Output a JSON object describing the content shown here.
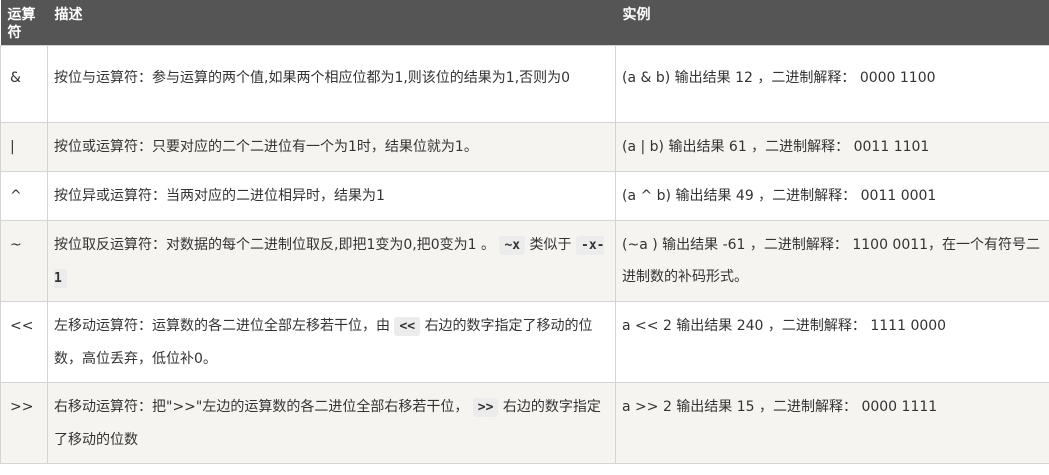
{
  "header": {
    "col_operator": "运算符",
    "col_description": "描述",
    "col_example": "实例"
  },
  "rows": [
    {
      "operator": "&",
      "description": "按位与运算符：参与运算的两个值,如果两个相应位都为1,则该位的结果为1,否则为0",
      "example": "(a & b) 输出结果 12 ，二进制解释： 0000 1100"
    },
    {
      "operator": "|",
      "description": "按位或运算符：只要对应的二个二进位有一个为1时，结果位就为1。",
      "example": "(a | b) 输出结果 61 ，二进制解释： 0011 1101"
    },
    {
      "operator": "^",
      "description": "按位异或运算符：当两对应的二进位相异时，结果为1",
      "example": "(a ^ b) 输出结果 49 ，二进制解释： 0011 0001"
    },
    {
      "operator": "~",
      "description_before": "按位取反运算符：对数据的每个二进制位取反,即把1变为0,把0变为1 。",
      "code1": "~x",
      "description_mid": "类似于",
      "code2": "-x-1",
      "example": "(~a ) 输出结果 -61 ，二进制解释： 1100 0011，在一个有符号二进制数的补码形式。"
    },
    {
      "operator": "<<",
      "description_before": "左移动运算符：运算数的各二进位全部左移若干位，由",
      "code1": "<<",
      "description_after": "右边的数字指定了移动的位数，高位丢弃，低位补0。",
      "example": "a << 2 输出结果 240 ，二进制解释： 1111 0000"
    },
    {
      "operator": ">>",
      "description_before": "右移动运算符：把\">>\"左边的运算数的各二进位全部右移若干位，",
      "code1": ">>",
      "description_after": "右边的数字指定了移动的位数",
      "example": "a >> 2 输出结果 15 ，二进制解释： 0000 1111"
    }
  ]
}
